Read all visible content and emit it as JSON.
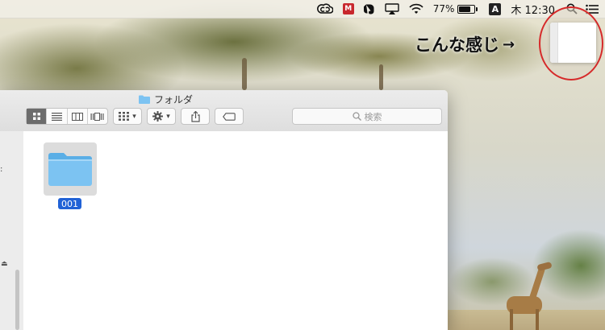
{
  "menubar": {
    "icons": [
      "creative-cloud-icon",
      "mcafee-icon",
      "evernote-icon",
      "airplay-icon",
      "wifi-icon",
      "battery-icon",
      "spotlight-icon",
      "notification-center-icon"
    ],
    "mcafee_letter": "M",
    "battery_percent": "77%",
    "battery_level": 0.77,
    "input_source": "A",
    "clock": "木 12:30"
  },
  "annotation": {
    "text": "こんな感じ",
    "arrow": "→",
    "highlight_color": "#d62a2a"
  },
  "finder": {
    "title": "フォルダ",
    "view_modes": [
      "icon-view",
      "list-view",
      "column-view",
      "cover-flow-view"
    ],
    "active_view": "icon-view",
    "search_placeholder": "検索",
    "items": [
      {
        "name": "001",
        "selected": true
      }
    ]
  },
  "colors": {
    "selection": "#2062d6",
    "folder": "#7cc3f2"
  }
}
